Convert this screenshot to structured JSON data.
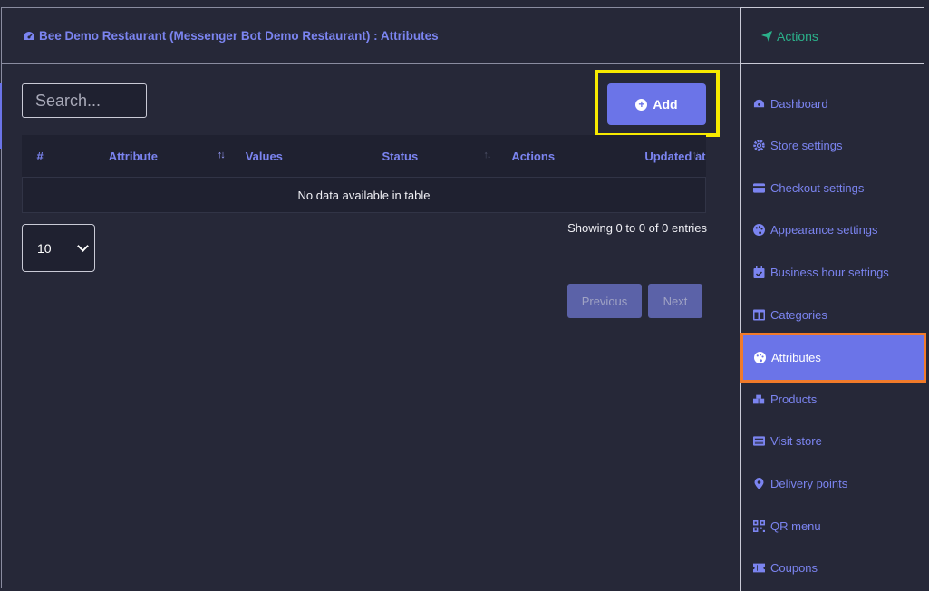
{
  "header": {
    "title": "Bee Demo Restaurant (Messenger Bot Demo Restaurant) : Attributes"
  },
  "search": {
    "placeholder": "Search..."
  },
  "toolbar": {
    "add_label": "Add"
  },
  "table": {
    "columns": [
      "#",
      "Attribute",
      "Values",
      "Status",
      "Actions",
      "Updated at"
    ],
    "empty_message": "No data available in table"
  },
  "length_select": {
    "value": "10"
  },
  "info": "Showing 0 to 0 of 0 entries",
  "pagination": {
    "previous_label": "Previous",
    "next_label": "Next"
  },
  "sidebar": {
    "title": "Actions",
    "items": [
      {
        "label": "Dashboard",
        "icon": "tachometer-icon"
      },
      {
        "label": "Store settings",
        "icon": "gear-icon"
      },
      {
        "label": "Checkout settings",
        "icon": "credit-card-icon"
      },
      {
        "label": "Appearance settings",
        "icon": "palette-icon"
      },
      {
        "label": "Business hour settings",
        "icon": "calendar-check-icon"
      },
      {
        "label": "Categories",
        "icon": "columns-icon"
      },
      {
        "label": "Attributes",
        "icon": "palette-icon",
        "active": true
      },
      {
        "label": "Products",
        "icon": "boxes-icon"
      },
      {
        "label": "Visit store",
        "icon": "list-alt-icon"
      },
      {
        "label": "Delivery points",
        "icon": "map-marker-icon"
      },
      {
        "label": "QR menu",
        "icon": "qrcode-icon"
      },
      {
        "label": "Coupons",
        "icon": "ticket-icon"
      }
    ]
  },
  "colors": {
    "accent": "#6b74e8",
    "background": "#262838",
    "highlight_yellow": "#f7ea00",
    "highlight_orange": "#f07a2a",
    "actions_green": "#2bb08a"
  }
}
